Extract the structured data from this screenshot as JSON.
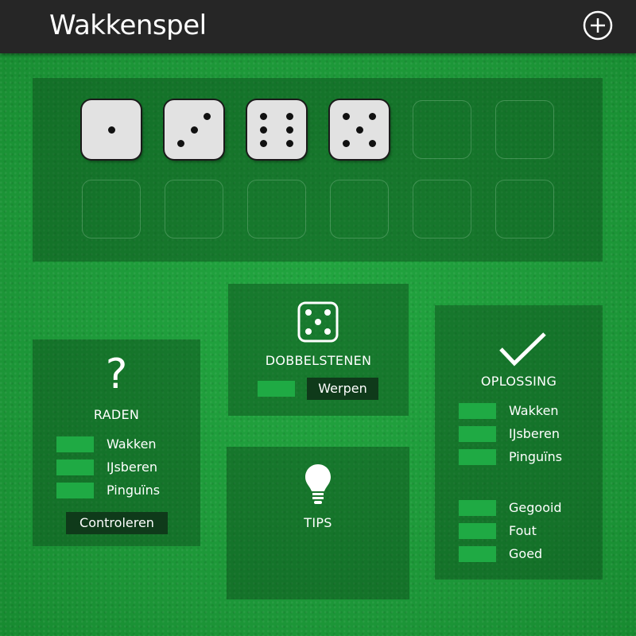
{
  "header": {
    "title": "Wakkenspel",
    "add_icon": "plus-circle-icon"
  },
  "dice": {
    "rolled_values": [
      1,
      3,
      6,
      5
    ],
    "empty_slots_row1": 2,
    "empty_slots_row2": 6
  },
  "raden": {
    "icon": "question-mark-icon",
    "icon_glyph": "?",
    "title": "RADEN",
    "fields": [
      {
        "label": "Wakken",
        "value": ""
      },
      {
        "label": "IJsberen",
        "value": ""
      },
      {
        "label": "Pinguïns",
        "value": ""
      }
    ],
    "check_button": "Controleren"
  },
  "dobbelstenen": {
    "icon": "die-five-icon",
    "title": "DOBBELSTENEN",
    "count_value": "",
    "roll_button": "Werpen"
  },
  "tips": {
    "icon": "lightbulb-icon",
    "title": "TIPS"
  },
  "oplossing": {
    "icon": "checkmark-icon",
    "title": "OPLOSSING",
    "fields": [
      {
        "label": "Wakken",
        "value": ""
      },
      {
        "label": "IJsberen",
        "value": ""
      },
      {
        "label": "Pinguïns",
        "value": ""
      }
    ],
    "stats": [
      {
        "label": "Gegooid",
        "value": ""
      },
      {
        "label": "Fout",
        "value": ""
      },
      {
        "label": "Goed",
        "value": ""
      }
    ]
  },
  "colors": {
    "felt": "#1f9a3b",
    "panel": "#0a4619",
    "field": "#1faa44",
    "button": "#0f3a1a",
    "topbar": "#262626"
  }
}
